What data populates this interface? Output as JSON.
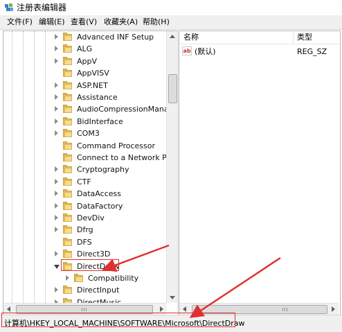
{
  "window": {
    "title": "注册表编辑器"
  },
  "menu": [
    "文件(F)",
    "编辑(E)",
    "查看(V)",
    "收藏夹(A)",
    "帮助(H)"
  ],
  "tree": {
    "items": [
      {
        "label": "Advanced INF Setup",
        "expander": "right",
        "indent": 0
      },
      {
        "label": "ALG",
        "expander": "right",
        "indent": 0
      },
      {
        "label": "AppV",
        "expander": "right",
        "indent": 0
      },
      {
        "label": "AppVISV",
        "expander": "none",
        "indent": 0
      },
      {
        "label": "ASP.NET",
        "expander": "right",
        "indent": 0
      },
      {
        "label": "Assistance",
        "expander": "right",
        "indent": 0
      },
      {
        "label": "AudioCompressionManag",
        "expander": "right",
        "indent": 0
      },
      {
        "label": "BidInterface",
        "expander": "right",
        "indent": 0
      },
      {
        "label": "COM3",
        "expander": "right",
        "indent": 0
      },
      {
        "label": "Command Processor",
        "expander": "none",
        "indent": 0
      },
      {
        "label": "Connect to a Network Pro",
        "expander": "none",
        "indent": 0
      },
      {
        "label": "Cryptography",
        "expander": "right",
        "indent": 0
      },
      {
        "label": "CTF",
        "expander": "right",
        "indent": 0
      },
      {
        "label": "DataAccess",
        "expander": "right",
        "indent": 0
      },
      {
        "label": "DataFactory",
        "expander": "right",
        "indent": 0
      },
      {
        "label": "DevDiv",
        "expander": "right",
        "indent": 0
      },
      {
        "label": "Dfrg",
        "expander": "right",
        "indent": 0
      },
      {
        "label": "DFS",
        "expander": "none",
        "indent": 0
      },
      {
        "label": "Direct3D",
        "expander": "right",
        "indent": 0
      },
      {
        "label": "DirectDraw",
        "expander": "down",
        "indent": 0,
        "selected": true
      },
      {
        "label": "Compatibility",
        "expander": "right",
        "indent": 1
      },
      {
        "label": "DirectInput",
        "expander": "right",
        "indent": 0
      },
      {
        "label": "DirectMusic",
        "expander": "right",
        "indent": 0
      }
    ]
  },
  "list": {
    "columns": [
      "名称",
      "类型"
    ],
    "rows": [
      {
        "icon": "ab",
        "name": "(默认)",
        "type": "REG_SZ"
      }
    ]
  },
  "status": {
    "path": "计算机\\HKEY_LOCAL_MACHINE\\SOFTWARE\\Microsoft\\DirectDraw"
  },
  "colors": {
    "annotation": "#e03030",
    "folder": "#e8c363"
  }
}
